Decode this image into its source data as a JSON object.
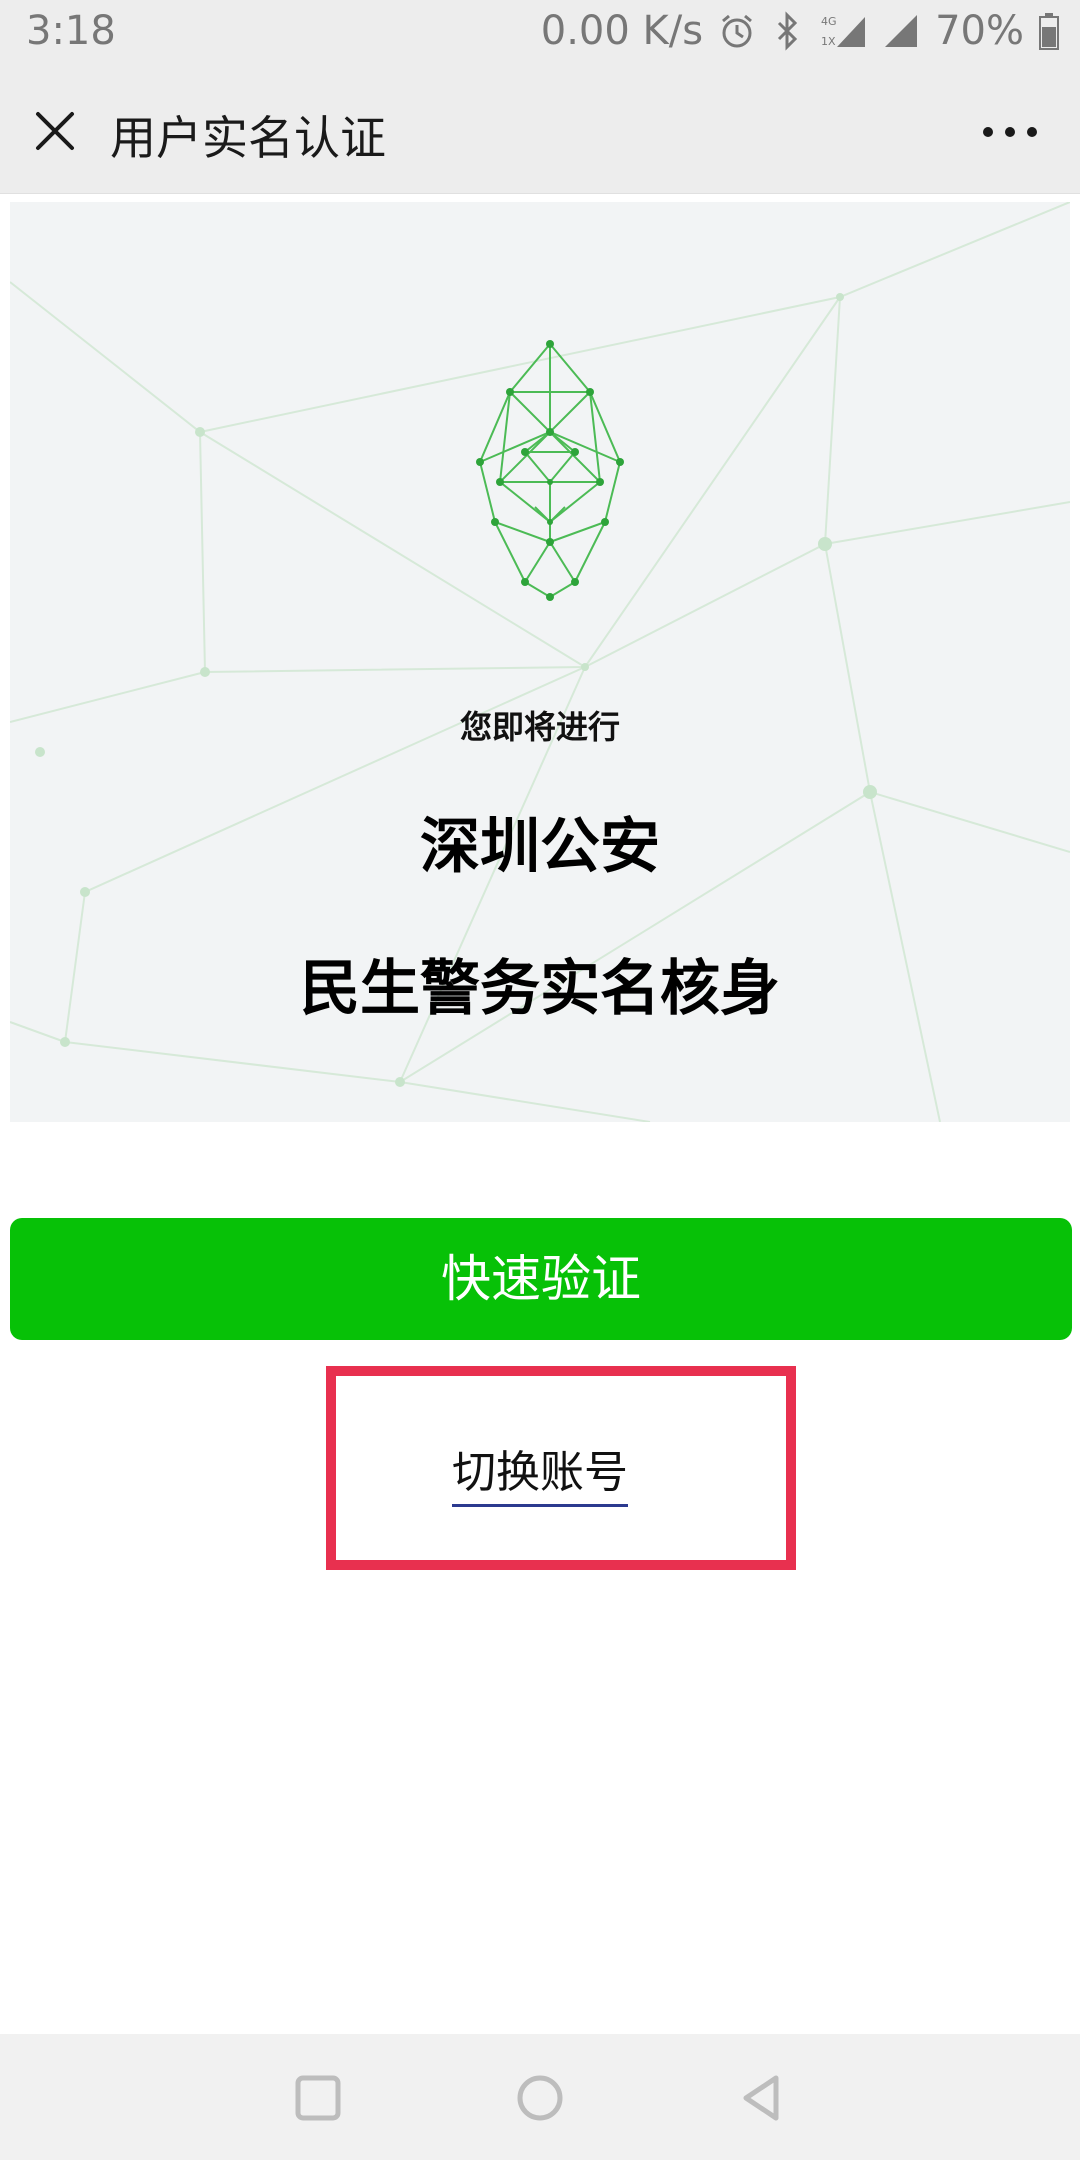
{
  "status_bar": {
    "time": "3:18",
    "network_speed": "0.00 K/s",
    "battery": "70%",
    "icons": [
      "alarm-icon",
      "bluetooth-icon",
      "signal-4g-icon",
      "signal-icon",
      "battery-icon"
    ]
  },
  "header": {
    "title": "用户实名认证",
    "close_icon": "close-icon",
    "more_icon": "more-icon"
  },
  "hero": {
    "subtitle": "您即将进行",
    "title_line1": "深圳公安",
    "title_line2": "民生警务实名核身",
    "icon": "face-recognition-icon"
  },
  "actions": {
    "verify_label": "快速验证",
    "switch_account_label": "切换账号"
  },
  "colors": {
    "accent_green": "#07c107",
    "highlight_red": "#e8304f",
    "header_bg": "#ededed",
    "hero_bg": "#f2f4f5"
  },
  "nav_bar": {
    "buttons": [
      "recent-apps-icon",
      "home-icon",
      "back-icon"
    ]
  }
}
